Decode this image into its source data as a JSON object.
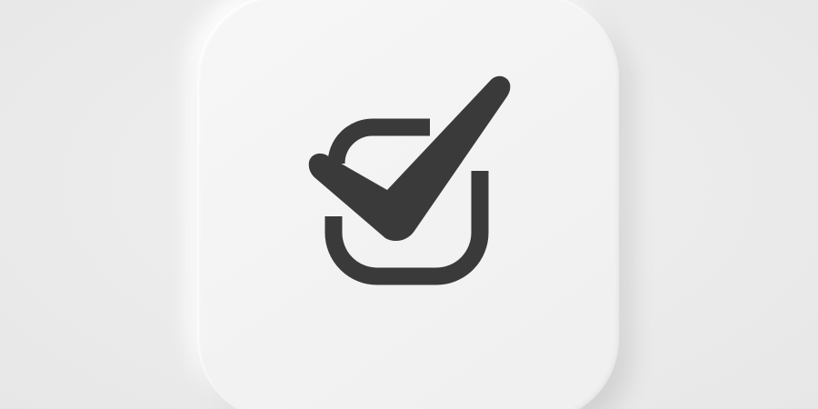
{
  "app_icon": {
    "icon": "checkbox-checked-icon",
    "tile_color": "#f4f4f4",
    "background_color": "#ebebeb",
    "glyph_color": "#3a3a3a"
  }
}
